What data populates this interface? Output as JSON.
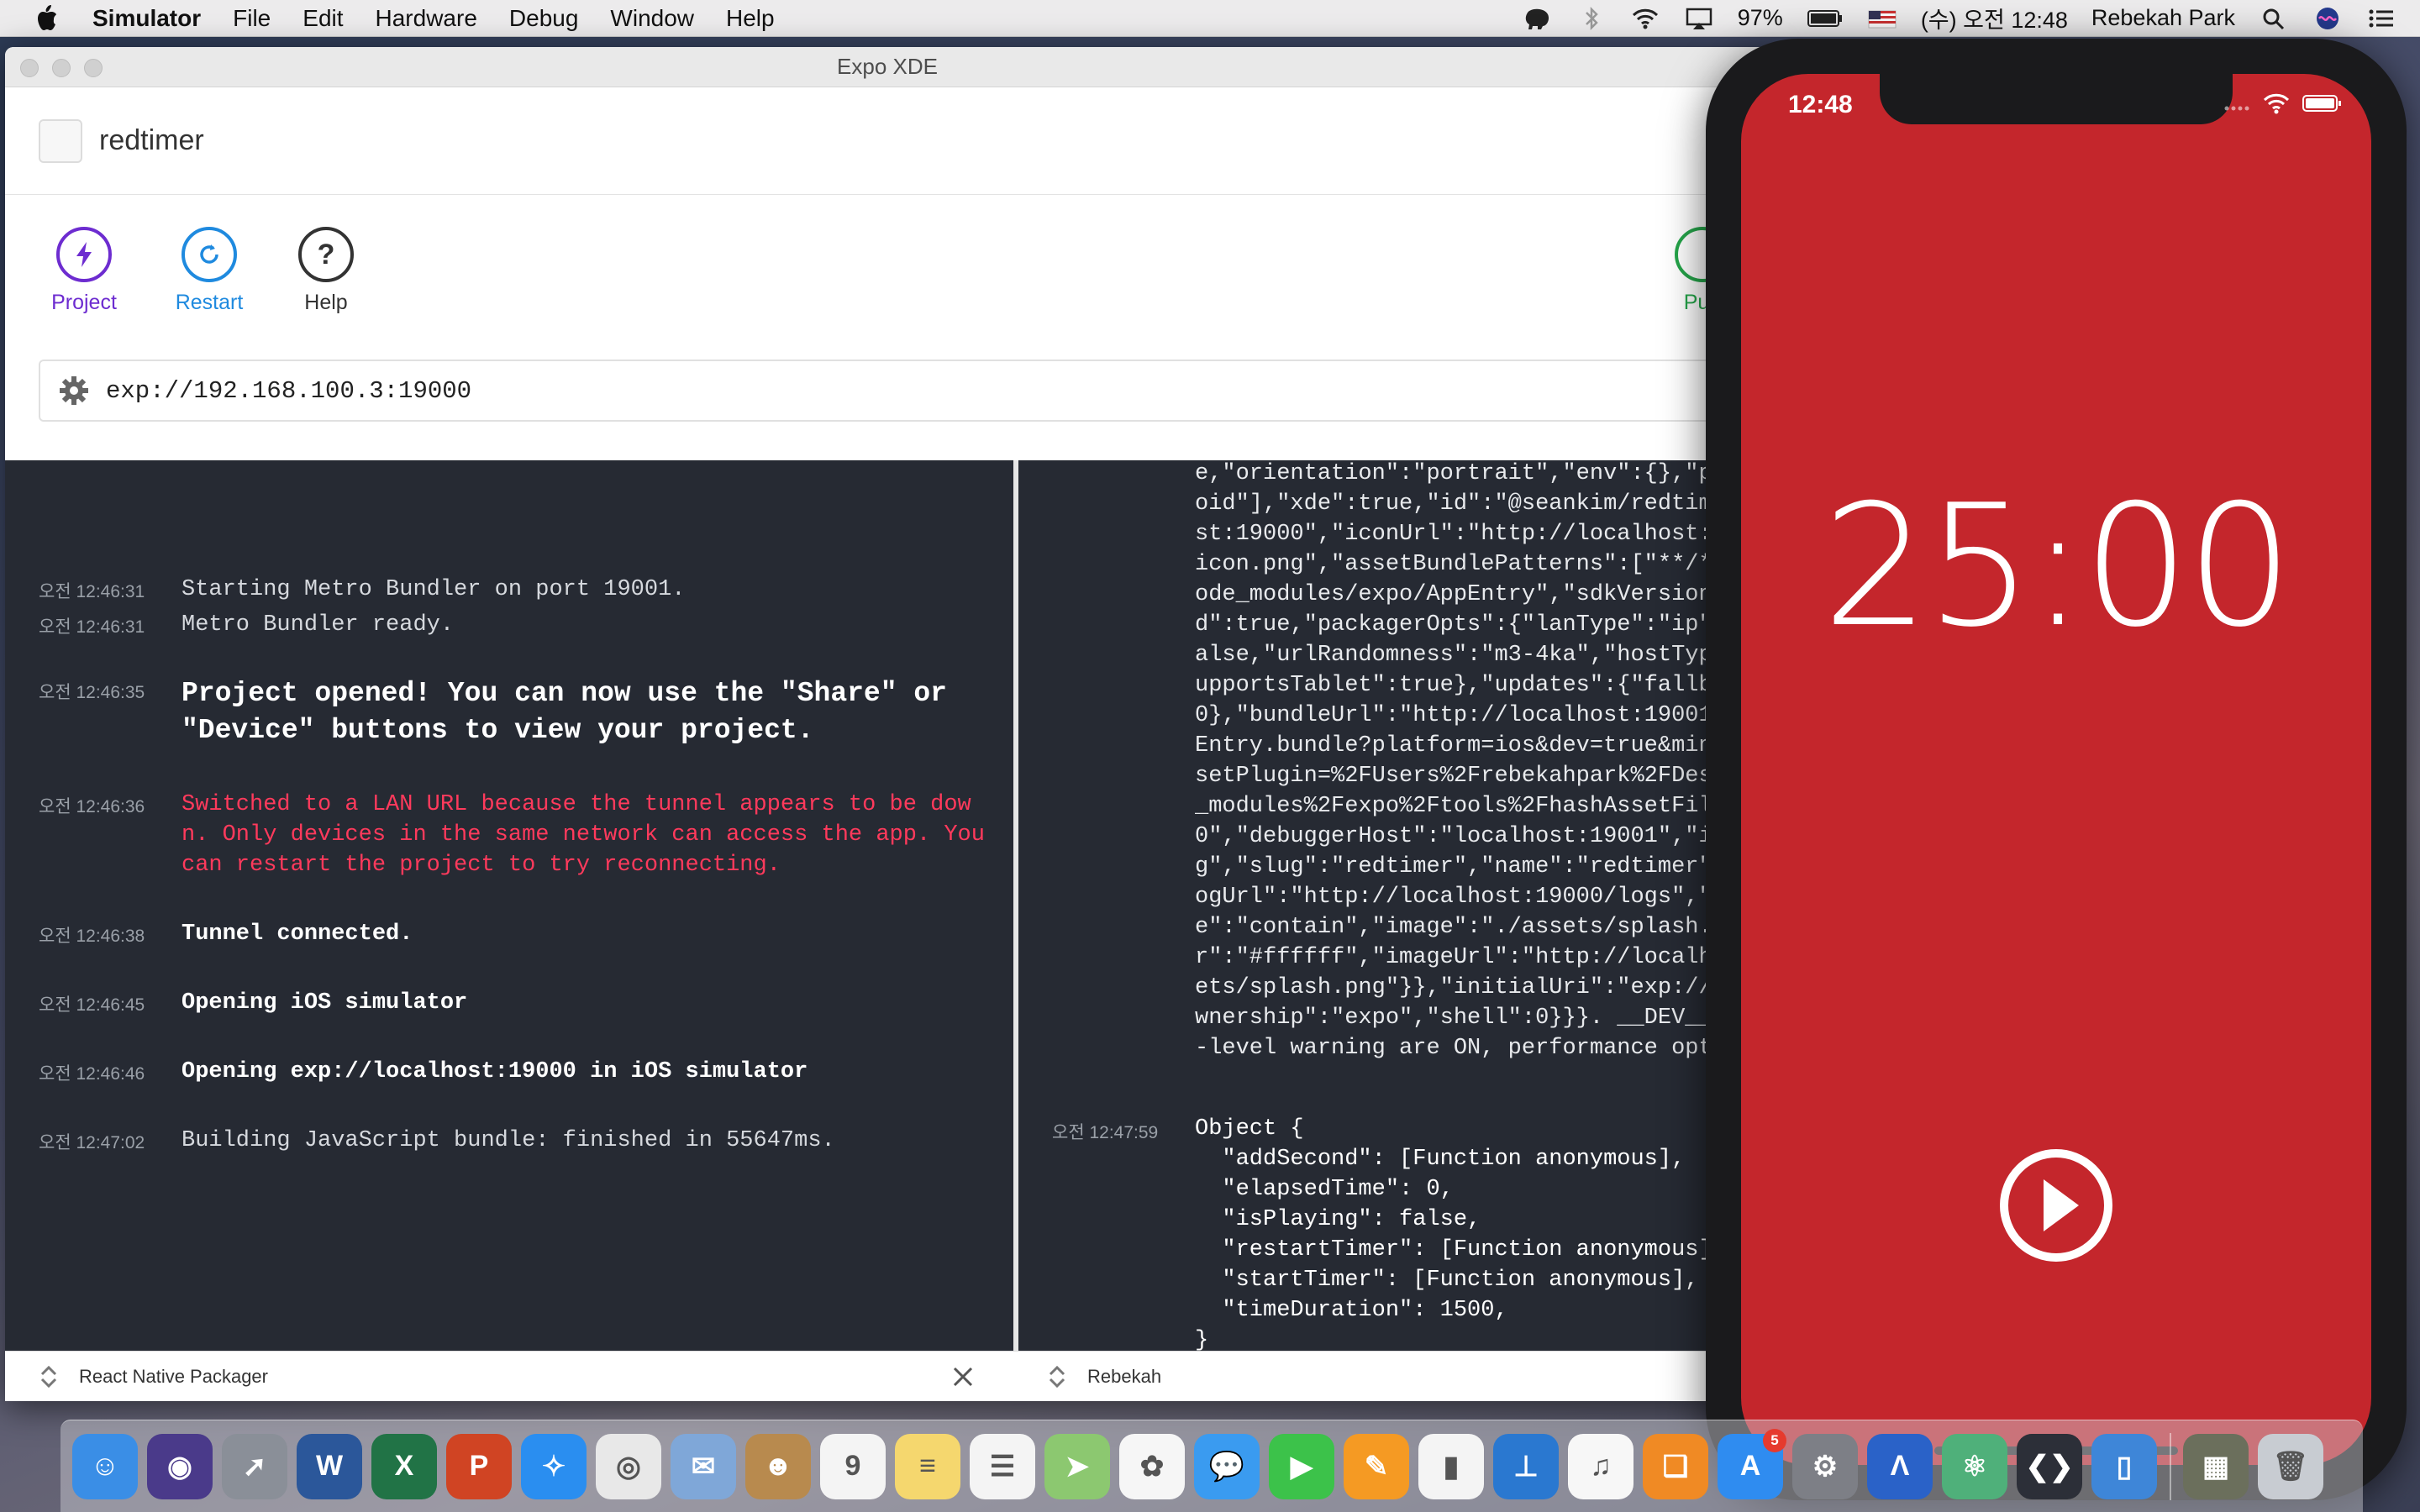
{
  "menubar": {
    "app_name": "Simulator",
    "menus": [
      "File",
      "Edit",
      "Hardware",
      "Debug",
      "Window",
      "Help"
    ],
    "battery": "97%",
    "clock": "(수) 오전 12:48",
    "user": "Rebekah Park",
    "icons": [
      "apple-icon",
      "evernote-elephant-icon",
      "bluetooth-icon",
      "wifi-icon",
      "airplay-icon",
      "battery-icon",
      "us-flag-icon",
      "spotlight-search-icon",
      "siri-icon",
      "notification-center-icon"
    ]
  },
  "xde": {
    "window_title": "Expo XDE",
    "project_name": "redtimer",
    "toolbar": {
      "project_label": "Project",
      "restart_label": "Restart",
      "help_label": "Help",
      "publish_label": "Pub",
      "colors": {
        "project": "#6d2cd0",
        "restart": "#1f8adf",
        "publish": "#25a54a"
      }
    },
    "url": "exp://192.168.100.3:19000",
    "packager_logs": [
      {
        "time": "오전 12:46:31",
        "message": "Starting Metro Bundler on port 19001.",
        "style": "normal"
      },
      {
        "time": "오전 12:46:31",
        "message": "Metro Bundler ready.",
        "style": "normal"
      },
      {
        "time": "오전 12:46:35",
        "message": "Project opened! You can now use the \"Share\" or \"Device\" buttons to view your project.",
        "style": "big"
      },
      {
        "time": "오전 12:46:36",
        "message": "Switched to a LAN URL because the tunnel appears to be down. Only devices in the same network can access the app. You can restart the project to try reconnecting.",
        "style": "error"
      },
      {
        "time": "오전 12:46:38",
        "message": "Tunnel connected.",
        "style": "bold"
      },
      {
        "time": "오전 12:46:45",
        "message": "Opening iOS simulator",
        "style": "bold"
      },
      {
        "time": "오전 12:46:46",
        "message": "Opening exp://localhost:19000 in iOS simulator",
        "style": "bold"
      },
      {
        "time": "오전 12:47:02",
        "message": "Building JavaScript bundle: finished in 55647ms.",
        "style": "normal"
      }
    ],
    "device_log_json_lines": [
      "e,\"orientation\":\"portrait\",\"env\":{},\"pl",
      "oid\"],\"xde\":true,\"id\":\"@seankim/redtime",
      "st:19000\",\"iconUrl\":\"http://localhost:1",
      "icon.png\",\"assetBundlePatterns\":[\"**/*\"",
      "ode_modules/expo/AppEntry\",\"sdkVersion\"",
      "d\":true,\"packagerOpts\":{\"lanType\":\"ip\",\"",
      "alse,\"urlRandomness\":\"m3-4ka\",\"hostType\"",
      "upportsTablet\":true},\"updates\":{\"fallbac",
      "0},\"bundleUrl\":\"http://localhost:19001/",
      "Entry.bundle?platform=ios&dev=true&minif",
      "setPlugin=%2FUsers%2Frebekahpark%2FDeskt",
      "_modules%2Fexpo%2Ftools%2FhashAssetFiles",
      "0\",\"debuggerHost\":\"localhost:19001\",\"ic",
      "g\",\"slug\":\"redtimer\",\"name\":\"redtimer\",",
      "ogUrl\":\"http://localhost:19000/logs\",\"sp",
      "e\":\"contain\",\"image\":\"./assets/splash.p",
      "r\":\"#ffffff\",\"imageUrl\":\"http://localhos",
      "ets/splash.png\"}},\"initialUri\":\"exp://l",
      "wnership\":\"expo\",\"shell\":0}}}. __DEV__ =",
      "-level warning are ON, performance optim"
    ],
    "device_object_log": {
      "time": "오전 12:47:59",
      "lines": [
        "Object {",
        "  \"addSecond\": [Function anonymous],",
        "  \"elapsedTime\": 0,",
        "  \"isPlaying\": false,",
        "  \"restartTimer\": [Function anonymous],",
        "  \"startTimer\": [Function anonymous],",
        "  \"timeDuration\": 1500,",
        "}"
      ]
    },
    "footer": {
      "left_tab": "React Native Packager",
      "right_tab": "Rebekah"
    }
  },
  "simulator": {
    "status_time": "12:48",
    "timer": "25:00",
    "background_color": "#c4262c",
    "play_button_icon": "play-circle-icon"
  },
  "dock": {
    "apps": [
      {
        "name": "Finder",
        "icon": "finder-icon",
        "color": "#3a8ee6",
        "glyph": "☺"
      },
      {
        "name": "Siri",
        "icon": "siri-icon",
        "color": "#4a3a8a",
        "glyph": "◉"
      },
      {
        "name": "Launchpad",
        "icon": "launchpad-rocket-icon",
        "color": "#8a8f98",
        "glyph": "➚"
      },
      {
        "name": "Word",
        "icon": "word-icon",
        "color": "#2b579a",
        "glyph": "W"
      },
      {
        "name": "Excel",
        "icon": "excel-icon",
        "color": "#217346",
        "glyph": "X"
      },
      {
        "name": "PowerPoint",
        "icon": "powerpoint-icon",
        "color": "#d04423",
        "glyph": "P"
      },
      {
        "name": "Safari",
        "icon": "safari-compass-icon",
        "color": "#2a8ef0",
        "glyph": "✧"
      },
      {
        "name": "Chrome",
        "icon": "chrome-icon",
        "color": "#e8e8e8",
        "glyph": "◎"
      },
      {
        "name": "Mail",
        "icon": "mail-eagle-icon",
        "color": "#7fa7d8",
        "glyph": "✉"
      },
      {
        "name": "Contacts",
        "icon": "contacts-icon",
        "color": "#b88a4e",
        "glyph": "☻"
      },
      {
        "name": "Calendar",
        "icon": "calendar-icon",
        "color": "#f4f4f4",
        "glyph": "9"
      },
      {
        "name": "Notes",
        "icon": "notes-icon",
        "color": "#f5d76e",
        "glyph": "≡"
      },
      {
        "name": "Reminders",
        "icon": "reminders-icon",
        "color": "#f4f4f4",
        "glyph": "☰"
      },
      {
        "name": "Maps",
        "icon": "maps-icon",
        "color": "#8cc870",
        "glyph": "➤"
      },
      {
        "name": "Photos",
        "icon": "photos-icon",
        "color": "#f6f6f6",
        "glyph": "✿"
      },
      {
        "name": "Messages",
        "icon": "messages-icon",
        "color": "#3a9bf0",
        "glyph": "💬"
      },
      {
        "name": "FaceTime",
        "icon": "facetime-icon",
        "color": "#3cc24a",
        "glyph": "▶"
      },
      {
        "name": "Pages",
        "icon": "pages-icon",
        "color": "#f59a23",
        "glyph": "✎"
      },
      {
        "name": "Numbers",
        "icon": "numbers-chart-icon",
        "color": "#f4f4f4",
        "glyph": "▮"
      },
      {
        "name": "Keynote",
        "icon": "keynote-icon",
        "color": "#2a78d0",
        "glyph": "⊥"
      },
      {
        "name": "iTunes",
        "icon": "itunes-icon",
        "color": "#f7f7f7",
        "glyph": "♫"
      },
      {
        "name": "iBooks",
        "icon": "ibooks-icon",
        "color": "#f08a24",
        "glyph": "❑"
      },
      {
        "name": "App Store",
        "icon": "app-store-icon",
        "color": "#2f8cf0",
        "glyph": "A",
        "badge": "5"
      },
      {
        "name": "System Preferences",
        "icon": "system-preferences-gear-icon",
        "color": "#7d7f86",
        "glyph": "⚙"
      },
      {
        "name": "Expo XDE",
        "icon": "expo-xde-icon",
        "color": "#2a62c8",
        "glyph": "Λ"
      },
      {
        "name": "Atom",
        "icon": "atom-icon",
        "color": "#4fb07a",
        "glyph": "⚛"
      },
      {
        "name": "Visual Studio Code",
        "icon": "vscode-icon",
        "color": "#2c2f38",
        "glyph": "❮❯"
      },
      {
        "name": "Simulator",
        "icon": "simulator-icon",
        "color": "#3e86d8",
        "glyph": "▯"
      },
      {
        "name": "Downloads",
        "icon": "downloads-stack-icon",
        "color": "#6b6f5c",
        "glyph": "▦"
      },
      {
        "name": "Trash",
        "icon": "trash-icon",
        "color": "#c8ccd2",
        "glyph": "🗑"
      }
    ]
  }
}
